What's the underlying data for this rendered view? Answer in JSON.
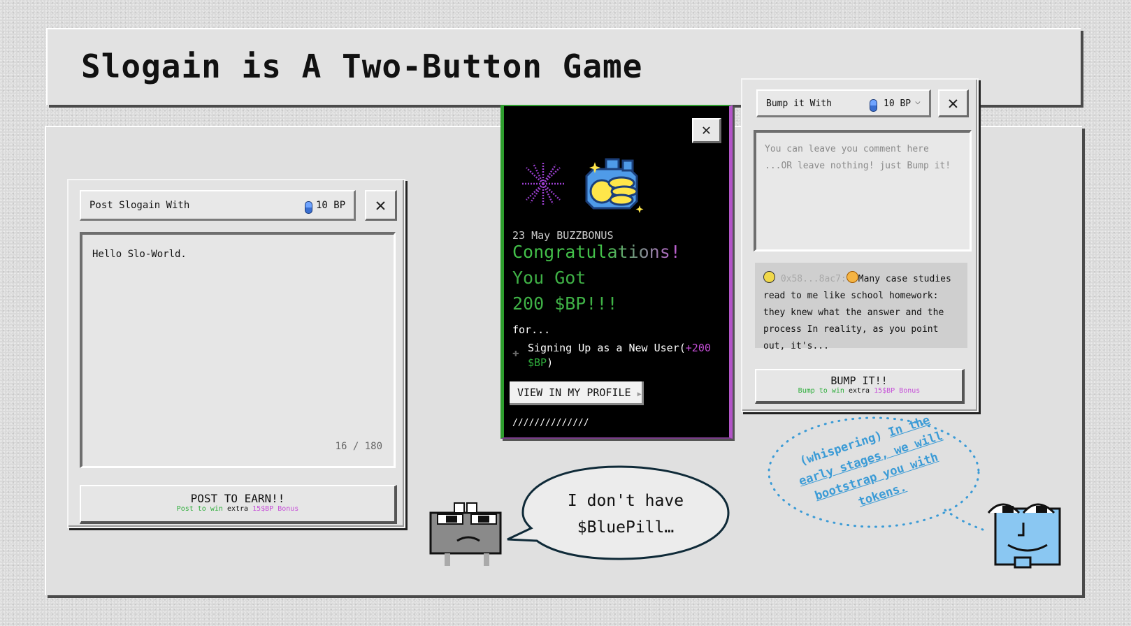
{
  "header": {
    "title": "Slogain is A Two-Button Game"
  },
  "post_window": {
    "selector_label": "Post Slogain With",
    "amount": "10 BP",
    "close_label": "✕",
    "text_value": "Hello Slo-World.",
    "counter": "16 / 180",
    "button_label": "POST TO EARN!!",
    "bonus_prefix": "Post to win",
    "bonus_mid": "extra",
    "bonus_amount": "15$BP Bonus"
  },
  "popup": {
    "close_label": "✕",
    "date_line": "23 May BUZZBONUS",
    "line1": "Congratulations!",
    "line2": "You Got",
    "line3": "200 $BP!!!",
    "for_label": "for...",
    "reason": "Signing Up as a New User(",
    "reason_bonus_a": "+200",
    "reason_bonus_b": "$BP",
    "reason_close": ")",
    "profile_button": "VIEW IN MY PROFILE",
    "footer": "//////////////"
  },
  "bump_window": {
    "selector_label": "Bump it With",
    "amount": "10 BP",
    "close_label": "✕",
    "placeholder": "You can leave you comment here\n...OR leave nothing! just Bump it!",
    "comment_address": "0x58...8ac7:",
    "comment_text": "Many case studies read to me like school homework: they knew what the answer and the process In reality, as you point out, it's...",
    "button_label": "BUMP IT!!",
    "bonus_prefix": "Bump to win",
    "bonus_mid": "extra",
    "bonus_amount": "15$BP Bonus"
  },
  "speech": {
    "text": "I don't have $BluePill…"
  },
  "whisper": {
    "prefix": "(whispering)",
    "text": "In the early stages, we will bootstrap you with tokens."
  },
  "colors": {
    "green": "#2fae3c",
    "magenta": "#c64fd8",
    "blue_text": "#3b9bd6"
  }
}
